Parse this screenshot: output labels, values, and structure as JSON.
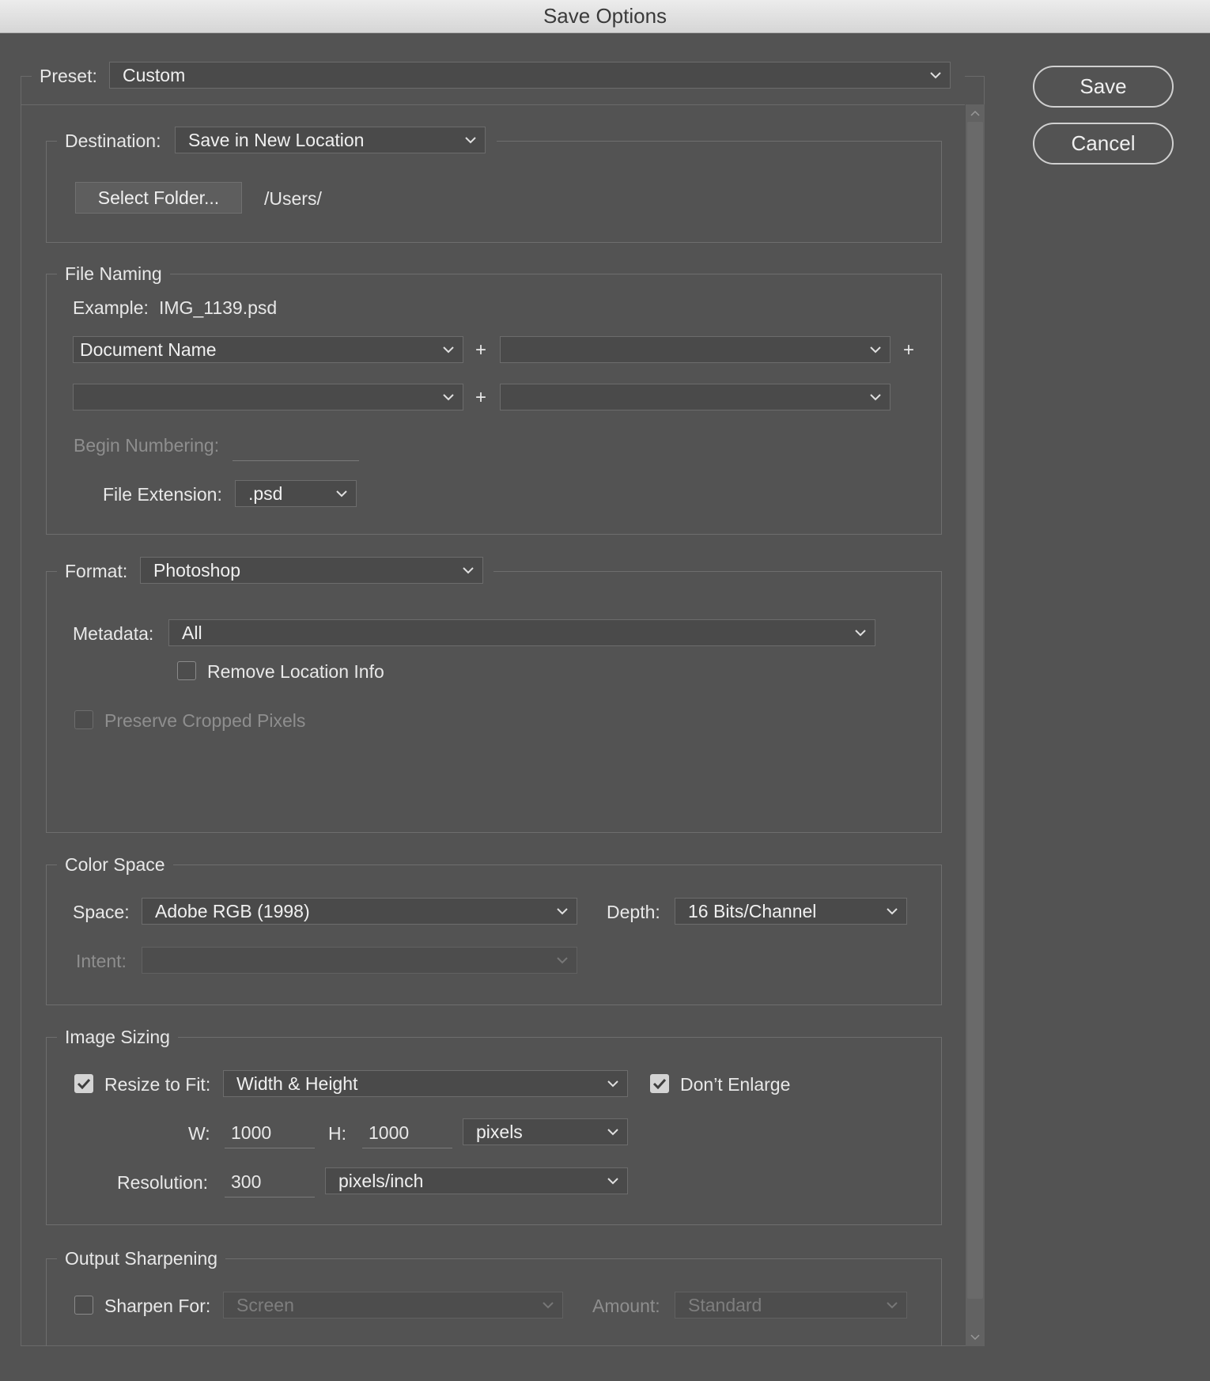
{
  "window": {
    "title": "Save Options"
  },
  "preset": {
    "label": "Preset:",
    "value": "Custom"
  },
  "actions": {
    "save": "Save",
    "cancel": "Cancel"
  },
  "destination": {
    "label": "Destination:",
    "value": "Save in New Location",
    "select_folder": "Select Folder...",
    "path": "/Users/"
  },
  "file_naming": {
    "title": "File Naming",
    "example_label": "Example:",
    "example_value": "IMG_1139.psd",
    "name_parts": [
      "Document Name",
      "",
      "",
      ""
    ],
    "plus": "+",
    "begin_numbering_label": "Begin Numbering:",
    "begin_numbering_value": "",
    "extension_label": "File Extension:",
    "extension_value": ".psd"
  },
  "format": {
    "label": "Format:",
    "value": "Photoshop",
    "metadata_label": "Metadata:",
    "metadata_value": "All",
    "remove_location_label": "Remove Location Info",
    "remove_location_checked": false,
    "preserve_cropped_label": "Preserve Cropped Pixels",
    "preserve_cropped_checked": false
  },
  "color_space": {
    "title": "Color Space",
    "space_label": "Space:",
    "space_value": "Adobe RGB (1998)",
    "depth_label": "Depth:",
    "depth_value": "16 Bits/Channel",
    "intent_label": "Intent:",
    "intent_value": ""
  },
  "image_sizing": {
    "title": "Image Sizing",
    "resize_label": "Resize to Fit:",
    "resize_checked": true,
    "resize_value": "Width & Height",
    "dont_enlarge_label": "Don’t Enlarge",
    "dont_enlarge_checked": true,
    "w_label": "W:",
    "w_value": "1000",
    "h_label": "H:",
    "h_value": "1000",
    "unit_value": "pixels",
    "resolution_label": "Resolution:",
    "resolution_value": "300",
    "resolution_unit": "pixels/inch"
  },
  "output_sharpening": {
    "title": "Output Sharpening",
    "sharpen_label": "Sharpen For:",
    "sharpen_checked": false,
    "sharpen_value": "Screen",
    "amount_label": "Amount:",
    "amount_value": "Standard"
  }
}
